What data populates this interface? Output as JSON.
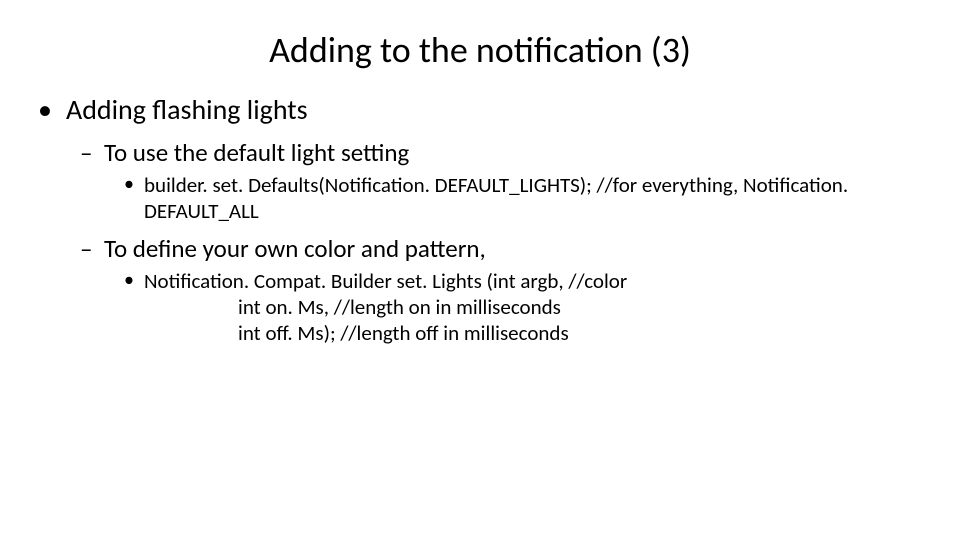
{
  "title": "Adding to the notification (3)",
  "bullets": {
    "lvl1_0": "Adding flashing lights",
    "lvl2_0": "To use the default light setting",
    "lvl3_0": "builder. set. Defaults(Notification. DEFAULT_LIGHTS);  //for everything, Notification. DEFAULT_ALL",
    "lvl2_1": "To define your own color and pattern,",
    "lvl3_1": "Notification. Compat. Builder set. Lights (int argb,  //color",
    "lvl3_1b": "int on. Ms, //length on in milliseconds",
    "lvl3_1c": "int off. Ms);  //length off in milliseconds"
  }
}
